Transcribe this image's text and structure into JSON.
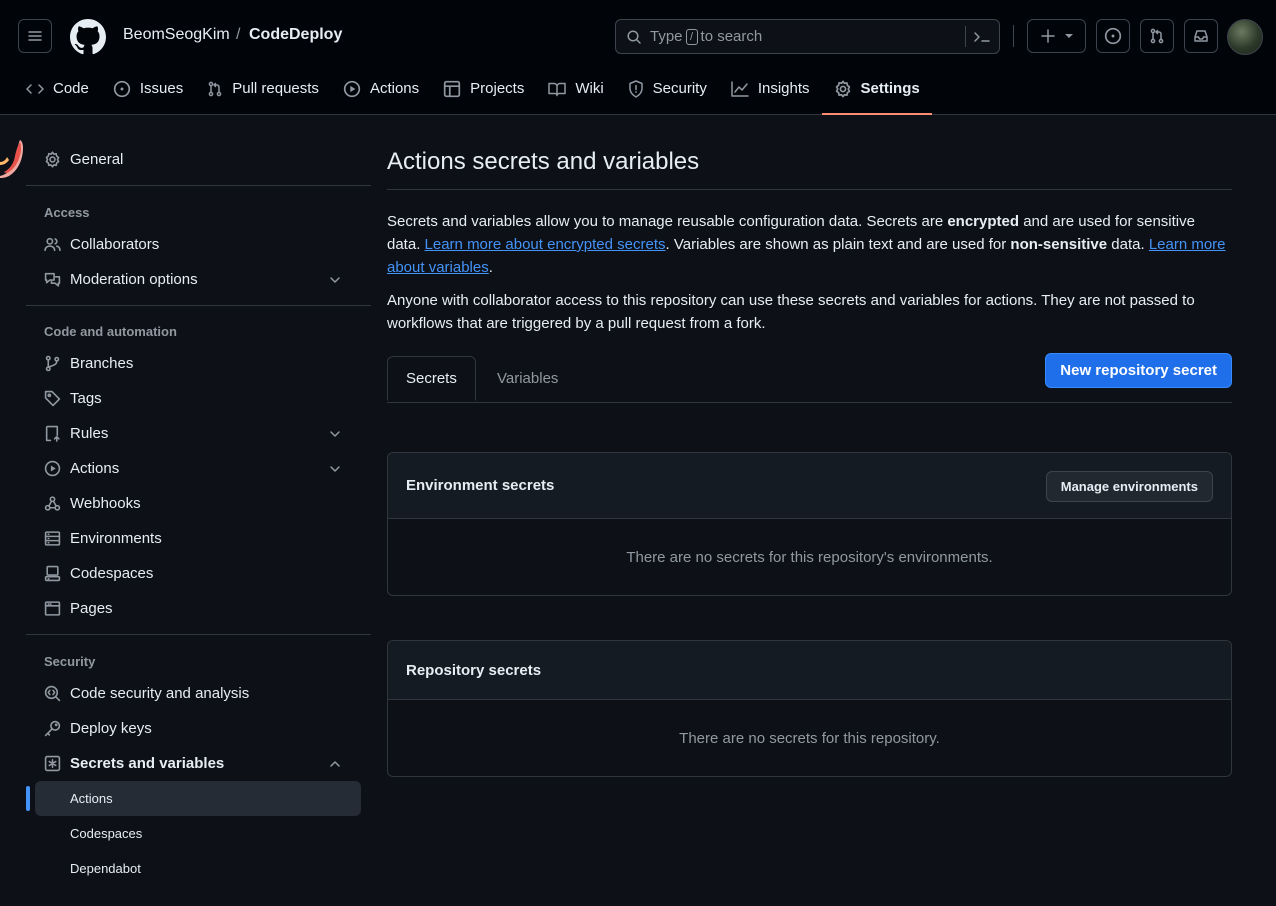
{
  "header": {
    "owner": "BeomSeogKim",
    "separator": "/",
    "repo": "CodeDeploy",
    "search": {
      "before": "Type",
      "key": "/",
      "after": "to search"
    }
  },
  "tabs": [
    {
      "label": "Code",
      "icon": "code-icon"
    },
    {
      "label": "Issues",
      "icon": "issue-icon"
    },
    {
      "label": "Pull requests",
      "icon": "pull-request-icon"
    },
    {
      "label": "Actions",
      "icon": "play-icon"
    },
    {
      "label": "Projects",
      "icon": "table-icon"
    },
    {
      "label": "Wiki",
      "icon": "book-icon"
    },
    {
      "label": "Security",
      "icon": "shield-icon"
    },
    {
      "label": "Insights",
      "icon": "graph-icon"
    },
    {
      "label": "Settings",
      "icon": "gear-icon",
      "active": true
    }
  ],
  "sidebar": {
    "general": "General",
    "access_heading": "Access",
    "collaborators": "Collaborators",
    "moderation": "Moderation options",
    "automation_heading": "Code and automation",
    "branches": "Branches",
    "tags": "Tags",
    "rules": "Rules",
    "actions": "Actions",
    "webhooks": "Webhooks",
    "environments": "Environments",
    "codespaces": "Codespaces",
    "pages": "Pages",
    "security_heading": "Security",
    "code_security": "Code security and analysis",
    "deploy_keys": "Deploy keys",
    "secrets": "Secrets and variables",
    "sub_actions": "Actions",
    "sub_codespaces": "Codespaces",
    "sub_dependabot": "Dependabot"
  },
  "main": {
    "title": "Actions secrets and variables",
    "p1": {
      "t1": "Secrets and variables allow you to manage reusable configuration data. Secrets are ",
      "b1": "encrypted",
      "t2": " and are used for sensitive data. ",
      "link1": "Learn more about encrypted secrets",
      "t3": ". Variables are shown as plain text and are used for ",
      "b2": "non-sensitive",
      "t4": " data. ",
      "link2": "Learn more about variables",
      "t5": "."
    },
    "p2": "Anyone with collaborator access to this repository can use these secrets and variables for actions. They are not passed to workflows that are triggered by a pull request from a fork.",
    "tab_secrets": "Secrets",
    "tab_variables": "Variables",
    "new_secret": "New repository secret",
    "env_title": "Environment secrets",
    "manage_env": "Manage environments",
    "env_empty": "There are no secrets for this repository's environments.",
    "repo_title": "Repository secrets",
    "repo_empty": "There are no secrets for this repository."
  },
  "colors": {
    "accent": "#1f6feb",
    "link": "#4493f8",
    "tab_underline": "#fd8c73",
    "bg": "#0d1117"
  }
}
